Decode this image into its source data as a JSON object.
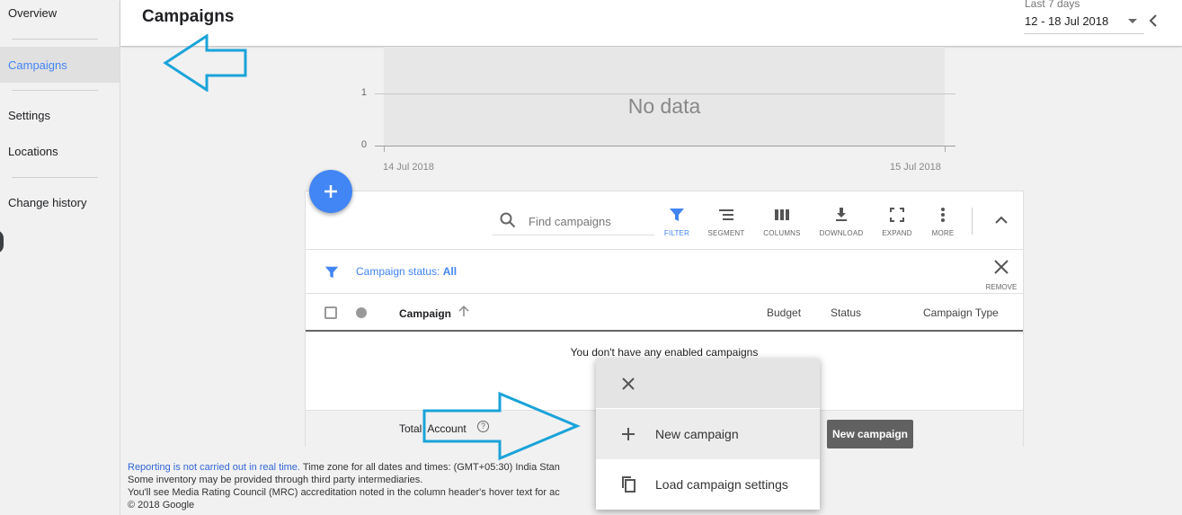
{
  "sidebar": {
    "items": [
      {
        "label": "Overview"
      },
      {
        "label": "Campaigns",
        "active": true
      },
      {
        "label": "Settings"
      },
      {
        "label": "Locations"
      },
      {
        "label": "Change history"
      }
    ]
  },
  "header": {
    "title": "Campaigns",
    "date_range_label": "Last 7 days",
    "date_range_value": "12 - 18 Jul 2018"
  },
  "chart": {
    "no_data_text": "No data",
    "y_ticks": [
      "1",
      "0"
    ],
    "x_ticks": [
      "14 Jul 2018",
      "15 Jul 2018"
    ]
  },
  "toolbar": {
    "search_placeholder": "Find campaigns",
    "tools": [
      {
        "label": "FILTER",
        "icon": "filter-icon"
      },
      {
        "label": "SEGMENT",
        "icon": "segment-icon"
      },
      {
        "label": "COLUMNS",
        "icon": "columns-icon"
      },
      {
        "label": "DOWNLOAD",
        "icon": "download-icon"
      },
      {
        "label": "EXPAND",
        "icon": "expand-icon"
      },
      {
        "label": "MORE",
        "icon": "more-vert-icon"
      }
    ]
  },
  "filter": {
    "prefix": "Campaign status: ",
    "value": "All",
    "remove_label": "REMOVE"
  },
  "table": {
    "columns": [
      "Campaign",
      "Budget",
      "Status",
      "Campaign Type"
    ],
    "empty_message": "You don't have any enabled campaigns",
    "total_label": "Total: Account"
  },
  "popup": {
    "items": [
      {
        "label": "New campaign",
        "icon": "plus-icon"
      },
      {
        "label": "Load campaign settings",
        "icon": "copy-icon"
      }
    ],
    "tooltip": "New campaign"
  },
  "footer": {
    "link_text": "Reporting is not carried out in real time.",
    "line1_rest": " Time zone for all dates and times: (GMT+05:30) India Stan",
    "line2": "Some inventory may be provided through third party intermediaries.",
    "line3": "You'll see Media Rating Council (MRC) accreditation noted in the column header's hover text for ac",
    "line4": "© 2018 Google"
  },
  "colors": {
    "accent": "#4285f4",
    "annotation": "#1aa3d9",
    "tooltip_bg": "#616161"
  }
}
